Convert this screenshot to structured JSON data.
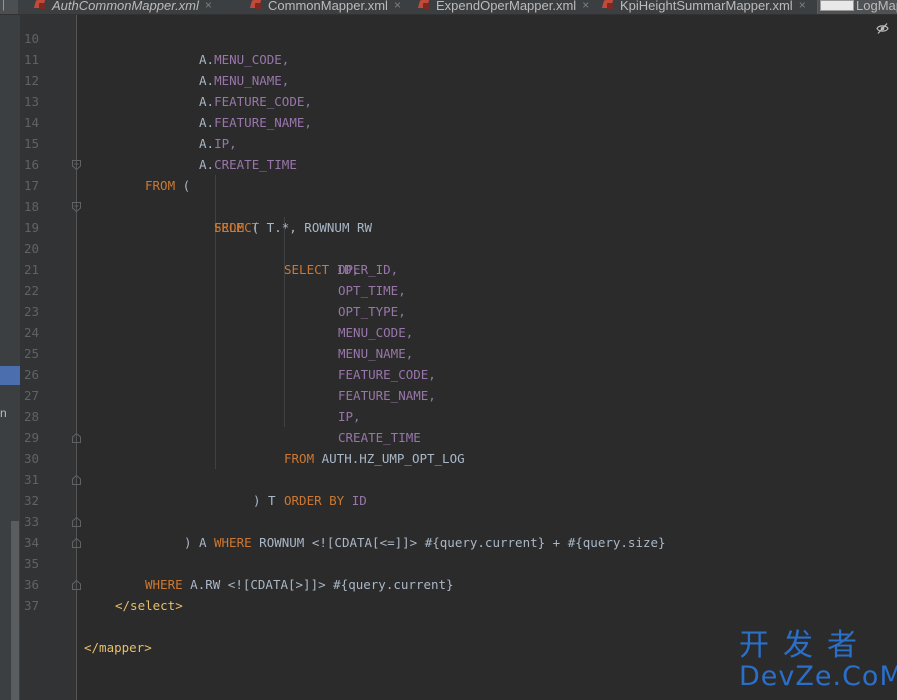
{
  "tabs": {
    "lead": "|",
    "items": [
      {
        "label": "AuthCommonMapper.xml",
        "italic": true
      },
      {
        "label": "CommonMapper.xml",
        "italic": false
      },
      {
        "label": "ExpendOperMapper.xml",
        "italic": false
      },
      {
        "label": "KpiHeightSummarMapper.xml",
        "italic": false
      },
      {
        "label": "LogMap",
        "italic": false
      }
    ],
    "close_glyph": "×"
  },
  "left_strip": {
    "fragment": "n"
  },
  "editor": {
    "colors": {
      "keyword": "#cc7832",
      "column": "#9876aa",
      "tag": "#e8bf6a",
      "text": "#a9b7c6",
      "line_number": "#606366"
    },
    "lines": [
      {
        "num": "10",
        "partial": true
      },
      {
        "num": "11"
      },
      {
        "num": "12"
      },
      {
        "num": "13"
      },
      {
        "num": "14"
      },
      {
        "num": "15"
      },
      {
        "num": "16"
      },
      {
        "num": "17"
      },
      {
        "num": "18"
      },
      {
        "num": "19"
      },
      {
        "num": "20"
      },
      {
        "num": "21"
      },
      {
        "num": "22"
      },
      {
        "num": "23"
      },
      {
        "num": "24"
      },
      {
        "num": "25"
      },
      {
        "num": "26"
      },
      {
        "num": "27"
      },
      {
        "num": "28"
      },
      {
        "num": "29"
      },
      {
        "num": "30"
      },
      {
        "num": "31"
      },
      {
        "num": "32"
      },
      {
        "num": "33"
      },
      {
        "num": "34"
      },
      {
        "num": "35"
      },
      {
        "num": "36"
      },
      {
        "num": "37"
      }
    ],
    "code": {
      "l10_a": "A.",
      "l10_b": "MENU_CODE,",
      "l11_a": "A.",
      "l11_b": "MENU_NAME,",
      "l12_a": "A.",
      "l12_b": "FEATURE_CODE,",
      "l13_a": "A.",
      "l13_b": "FEATURE_NAME,",
      "l14_a": "A.",
      "l14_b": "IP,",
      "l15_a": "A.",
      "l15_b": "CREATE_TIME",
      "l16_kw": "FROM",
      "l16_t": " (",
      "l17_kw": "SELECT",
      "l17_t": " T.*, ROWNUM RW",
      "l18_kw": "FROM",
      "l18_t": " (",
      "l19_kw": "SELECT",
      "l19_c": " ID,",
      "l20": "OPER_ID,",
      "l21": "OPT_TIME,",
      "l22": "OPT_TYPE,",
      "l23": "MENU_CODE,",
      "l24": "MENU_NAME,",
      "l25": "FEATURE_CODE,",
      "l26": "FEATURE_NAME,",
      "l27": "IP,",
      "l28": "CREATE_TIME",
      "l29_kw": "FROM",
      "l29_t": " AUTH.HZ_UMP_OPT_LOG",
      "l30_kw": "ORDER BY",
      "l30_c": " ID",
      "l31": ") T",
      "l32_kw": "WHERE",
      "l32_t": " ROWNUM <![CDATA[<=]]> #{query.current} + #{query.size}",
      "l33": ") A",
      "l34_kw": "WHERE",
      "l34_t": " A.RW <![CDATA[>]]> #{query.current}",
      "l35": "</select>",
      "l37": "</mapper>"
    }
  },
  "watermark": {
    "chinese": "开发者",
    "latin": "DevZe.CoM"
  }
}
